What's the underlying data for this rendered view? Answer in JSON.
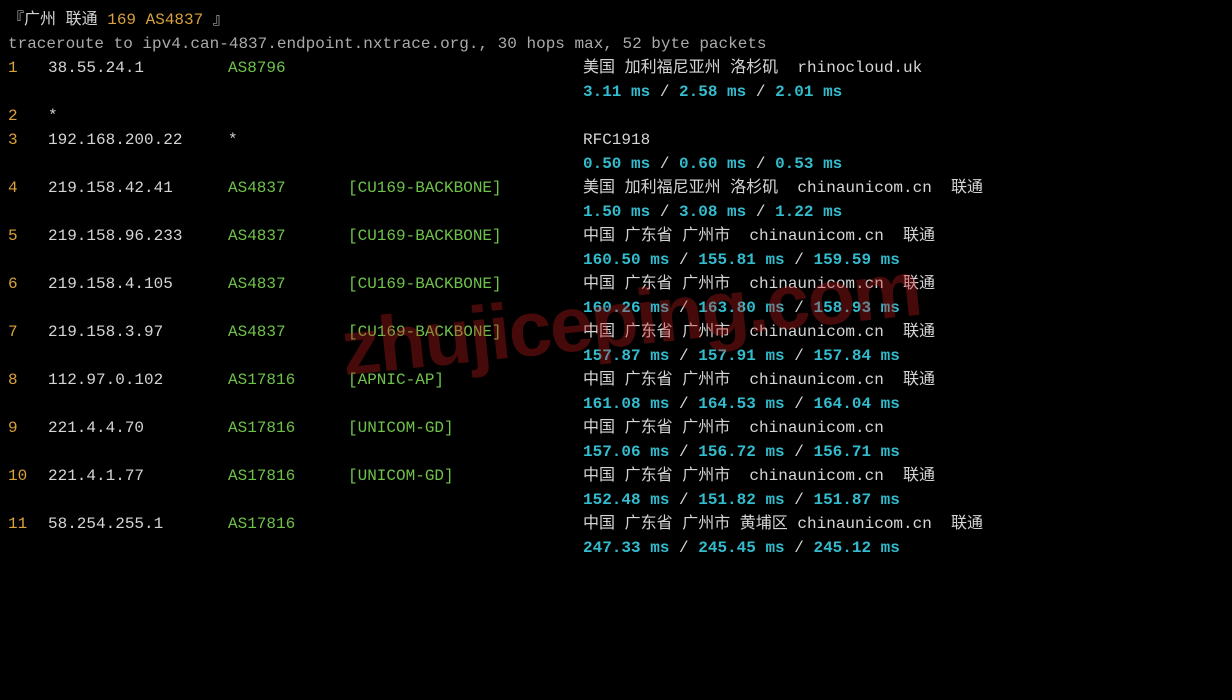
{
  "header": {
    "prefix": "『广州 联通 ",
    "asn": "169 AS4837",
    "suffix": " 』",
    "trace_line": "traceroute to ipv4.can-4837.endpoint.nxtrace.org., 30 hops max, 52 byte packets"
  },
  "watermark": "zhujiceping.com",
  "hops": [
    {
      "n": "1",
      "ip": "38.55.24.1",
      "asn": "AS8796",
      "tag": "",
      "geo": "美国 加利福尼亚州 洛杉矶  rhinocloud.uk",
      "lat": [
        "3.11 ms",
        "2.58 ms",
        "2.01 ms"
      ]
    },
    {
      "n": "2",
      "ip": "*",
      "asn": "",
      "tag": "",
      "geo": "",
      "lat": []
    },
    {
      "n": "3",
      "ip": "192.168.200.22",
      "asn": "*",
      "tag": "",
      "geo": "RFC1918",
      "lat": [
        "0.50 ms",
        "0.60 ms",
        "0.53 ms"
      ]
    },
    {
      "n": "4",
      "ip": "219.158.42.41",
      "asn": "AS4837",
      "tag": "[CU169-BACKBONE]",
      "geo": "美国 加利福尼亚州 洛杉矶  chinaunicom.cn  联通",
      "lat": [
        "1.50 ms",
        "3.08 ms",
        "1.22 ms"
      ]
    },
    {
      "n": "5",
      "ip": "219.158.96.233",
      "asn": "AS4837",
      "tag": "[CU169-BACKBONE]",
      "geo": "中国 广东省 广州市  chinaunicom.cn  联通",
      "lat": [
        "160.50 ms",
        "155.81 ms",
        "159.59 ms"
      ]
    },
    {
      "n": "6",
      "ip": "219.158.4.105",
      "asn": "AS4837",
      "tag": "[CU169-BACKBONE]",
      "geo": "中国 广东省 广州市  chinaunicom.cn  联通",
      "lat": [
        "160.26 ms",
        "163.80 ms",
        "158.93 ms"
      ]
    },
    {
      "n": "7",
      "ip": "219.158.3.97",
      "asn": "AS4837",
      "tag": "[CU169-BACKBONE]",
      "geo": "中国 广东省 广州市  chinaunicom.cn  联通",
      "lat": [
        "157.87 ms",
        "157.91 ms",
        "157.84 ms"
      ]
    },
    {
      "n": "8",
      "ip": "112.97.0.102",
      "asn": "AS17816",
      "tag": "[APNIC-AP]",
      "geo": "中国 广东省 广州市  chinaunicom.cn  联通",
      "lat": [
        "161.08 ms",
        "164.53 ms",
        "164.04 ms"
      ]
    },
    {
      "n": "9",
      "ip": "221.4.4.70",
      "asn": "AS17816",
      "tag": "[UNICOM-GD]",
      "geo": "中国 广东省 广州市  chinaunicom.cn",
      "lat": [
        "157.06 ms",
        "156.72 ms",
        "156.71 ms"
      ]
    },
    {
      "n": "10",
      "ip": "221.4.1.77",
      "asn": "AS17816",
      "tag": "[UNICOM-GD]",
      "geo": "中国 广东省 广州市  chinaunicom.cn  联通",
      "lat": [
        "152.48 ms",
        "151.82 ms",
        "151.87 ms"
      ]
    },
    {
      "n": "11",
      "ip": "58.254.255.1",
      "asn": "AS17816",
      "tag": "",
      "geo": "中国 广东省 广州市 黄埔区 chinaunicom.cn  联通",
      "lat": [
        "247.33 ms",
        "245.45 ms",
        "245.12 ms"
      ]
    }
  ]
}
